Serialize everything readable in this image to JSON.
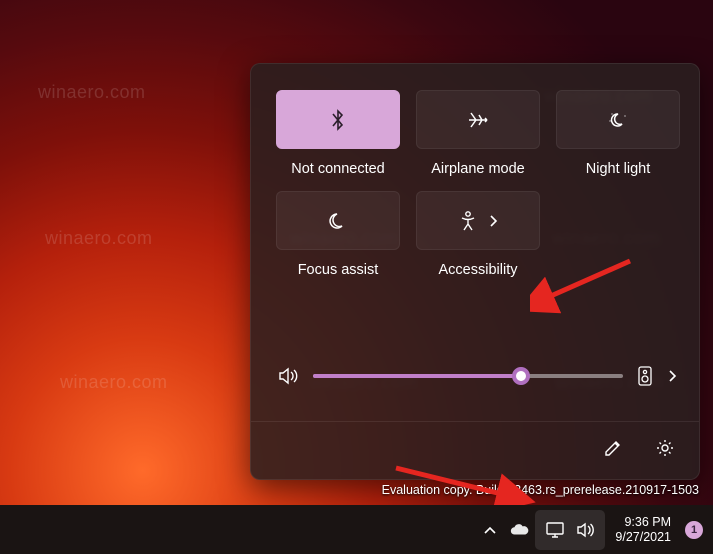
{
  "watermark_text": "winaero.com",
  "eval_text": "Evaluation copy. Build 22463.rs_prerelease.210917-1503",
  "flyout": {
    "tiles": {
      "bluetooth": {
        "label": "Not connected",
        "active": true
      },
      "airplane": {
        "label": "Airplane mode",
        "active": false
      },
      "nightlight": {
        "label": "Night light",
        "active": false
      },
      "focus": {
        "label": "Focus assist",
        "active": false
      },
      "accessibility": {
        "label": "Accessibility",
        "active": false
      }
    },
    "volume_percent": 67
  },
  "taskbar": {
    "time": "9:36 PM",
    "date": "9/27/2021",
    "notification_count": "1"
  }
}
